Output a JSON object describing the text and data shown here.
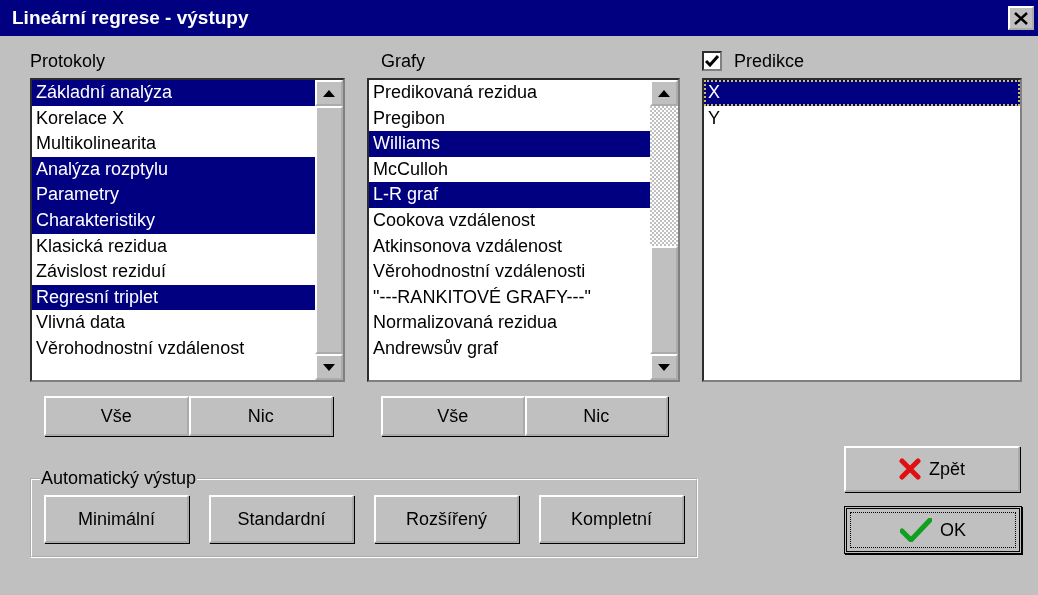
{
  "window": {
    "title": "Lineární regrese - výstupy"
  },
  "protokoly": {
    "label": "Protokoly",
    "items": [
      {
        "label": "Základní analýza",
        "selected": true
      },
      {
        "label": "Korelace X",
        "selected": false
      },
      {
        "label": "Multikolinearita",
        "selected": false
      },
      {
        "label": "Analýza rozptylu",
        "selected": true
      },
      {
        "label": "Parametry",
        "selected": true
      },
      {
        "label": "Charakteristiky",
        "selected": true
      },
      {
        "label": "Klasická rezidua",
        "selected": false
      },
      {
        "label": "Závislost reziduí",
        "selected": false
      },
      {
        "label": "Regresní triplet",
        "selected": true
      },
      {
        "label": "Vlivná data",
        "selected": false
      },
      {
        "label": "Věrohodnostní vzdálenost",
        "selected": false
      }
    ],
    "buttons": [
      "Vše",
      "Nic"
    ]
  },
  "grafy": {
    "label": "Grafy",
    "items": [
      {
        "label": "Predikovaná rezidua",
        "selected": false
      },
      {
        "label": "Pregibon",
        "selected": false
      },
      {
        "label": "Williams",
        "selected": true
      },
      {
        "label": "McCulloh",
        "selected": false
      },
      {
        "label": "L-R graf",
        "selected": true
      },
      {
        "label": "Cookova vzdálenost",
        "selected": false
      },
      {
        "label": "Atkinsonova vzdálenost",
        "selected": false
      },
      {
        "label": "Věrohodnostní vzdálenosti",
        "selected": false
      },
      {
        "label": "\"---RANKITOVÉ GRAFY---\"",
        "selected": false
      },
      {
        "label": "Normalizovaná rezidua",
        "selected": false
      },
      {
        "label": "Andrewsův graf",
        "selected": false
      }
    ],
    "buttons": [
      "Vše",
      "Nic"
    ]
  },
  "predikce": {
    "label": "Predikce",
    "checked": true,
    "items": [
      {
        "label": "X",
        "selected": true
      },
      {
        "label": "Y",
        "selected": false
      }
    ]
  },
  "automaticky_vystup": {
    "label": "Automatický výstup",
    "buttons": [
      "Minimální",
      "Standardní",
      "Rozšířený",
      "Kompletní"
    ]
  },
  "back_button": "Zpět",
  "ok_button": "OK"
}
